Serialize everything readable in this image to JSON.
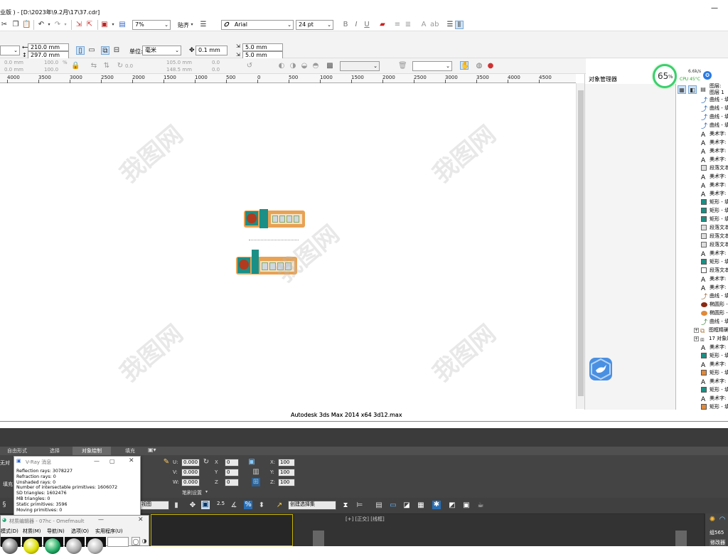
{
  "app": {
    "title": "业版 ) - [D:\\2023年\\9.2月\\17\\37.cdr]",
    "minimize_glyph": "—"
  },
  "toolbar1": {
    "zoom": "7%",
    "snap_label": "贴齐",
    "font_name": "Arial",
    "font_size": "24 pt"
  },
  "toolbar2": {
    "width": "210.0 mm",
    "height": "297.0 mm",
    "unit_label": "单位:",
    "unit_value": "毫米",
    "nudge": "0.1 mm",
    "dup_x": "5.0 mm",
    "dup_y": "5.0 mm"
  },
  "toolbar3": {
    "x": "0.0 mm",
    "y": "0.0 mm",
    "sx": "100.0",
    "sy": "100.0",
    "pct": "%",
    "angle": "0.0",
    "cx": "105.0 mm",
    "cy": "148.5 mm",
    "r1": "0.0",
    "r2": "0.0"
  },
  "ruler": {
    "ticks": [
      "4000",
      "3500",
      "3000",
      "2500",
      "2000",
      "1500",
      "1000",
      "500",
      "0",
      "500",
      "1000",
      "1500",
      "2000",
      "2500",
      "3000",
      "3500",
      "4000",
      "4500"
    ]
  },
  "object_manager": {
    "title": "对象管理器",
    "layer_label": "图层:",
    "layer_name": "图层 1",
    "items": [
      {
        "icon": "curve-icon",
        "label": "曲线 - 填"
      },
      {
        "icon": "curve-icon",
        "label": "曲线 - 填"
      },
      {
        "icon": "curve-icon",
        "label": "曲线 - 填"
      },
      {
        "icon": "curve-icon",
        "label": "曲线 - 填"
      },
      {
        "icon": "art-text-icon",
        "label": "美术字:"
      },
      {
        "icon": "art-text-icon",
        "label": "美术字:"
      },
      {
        "icon": "art-text-icon",
        "label": "美术字:"
      },
      {
        "icon": "art-text-icon",
        "label": "美术字:"
      },
      {
        "icon": "paragraph-text-icon",
        "label": "段落文本"
      },
      {
        "icon": "art-text-icon",
        "label": "美术字:"
      },
      {
        "icon": "art-text-icon",
        "label": "美术字:"
      },
      {
        "icon": "art-text-icon",
        "label": "美术字:"
      },
      {
        "icon": "rect-teal-icon",
        "label": "矩形 - 填"
      },
      {
        "icon": "rect-teal-icon",
        "label": "矩形 - 填"
      },
      {
        "icon": "rect-teal-icon",
        "label": "矩形 - 填"
      },
      {
        "icon": "paragraph-text-icon",
        "label": "段落文本"
      },
      {
        "icon": "paragraph-text-icon",
        "label": "段落文本"
      },
      {
        "icon": "paragraph-text-icon",
        "label": "段落文本"
      },
      {
        "icon": "art-text-icon",
        "label": "美术字:"
      },
      {
        "icon": "rect-teal-icon",
        "label": "矩形 - 填"
      },
      {
        "icon": "rect-white-icon",
        "label": "段落文本"
      },
      {
        "icon": "art-text-icon",
        "label": "美术字:"
      },
      {
        "icon": "art-text-icon",
        "label": "美术字:"
      },
      {
        "icon": "curve-brown-icon",
        "label": "曲线 - 填"
      },
      {
        "icon": "ellipse-brown-icon",
        "label": "椭圆形 -"
      },
      {
        "icon": "ellipse-orange-icon",
        "label": "椭圆形 -"
      },
      {
        "icon": "curve-green-icon",
        "label": "曲线 - 填"
      },
      {
        "icon": "powerclip-icon",
        "label": "图框精确"
      },
      {
        "icon": "group-icon",
        "label": "17 对象的"
      },
      {
        "icon": "art-text-icon",
        "label": "美术字:"
      },
      {
        "icon": "rect-teal-icon",
        "label": "矩形 - 填"
      },
      {
        "icon": "art-text-icon",
        "label": "美术字:"
      },
      {
        "icon": "rect-orange-icon",
        "label": "矩形 - 填"
      },
      {
        "icon": "art-text-icon",
        "label": "美术字:"
      },
      {
        "icon": "rect-teal-icon",
        "label": "矩形 - 填"
      },
      {
        "icon": "art-text-icon",
        "label": "美术字:"
      },
      {
        "icon": "rect-orange-icon",
        "label": "矩形 - 填"
      }
    ]
  },
  "monitor": {
    "percent": "65",
    "pct_sign": "%",
    "speed": "6.6k/s",
    "cpu": "CPU 45°C"
  },
  "max_title": "Autodesk 3ds Max  2014 x64      3d12.max",
  "max_tabs": [
    "自由形式",
    "选择",
    "对象绘制",
    "填充"
  ],
  "max_panel": {
    "left_label": "无对",
    "fill_label": "填充",
    "u": "0.000",
    "v": "0.000",
    "w": "0.000",
    "x": "0",
    "y": "0",
    "z": "0",
    "sx": "100",
    "sy": "100",
    "sz": "100",
    "brush_settings": "笔刷设置",
    "view_label": "视图",
    "selection_set": "创建选择集",
    "viewport_label": "[+] [正交] [线框]",
    "right_label": "组565",
    "right_label2": "修改器"
  },
  "vray": {
    "title": "V-Ray 消息",
    "lines": [
      "Reflection rays: 3078227",
      "Refraction rays: 0",
      "Unshaded rays: 0",
      "Number of intersectable primitives: 1606072",
      "SD triangles: 1602476",
      "MB triangles: 0",
      "Static primitives: 3596",
      "Moving primitives: 0"
    ]
  },
  "material_editor": {
    "title": "材质编辑器 - 07hc - Omefmault",
    "menu": [
      "模式(D)",
      "材质(M)",
      "导航(N)",
      "选项(O)",
      "实用程序(U)"
    ]
  },
  "watermark": "我图网"
}
